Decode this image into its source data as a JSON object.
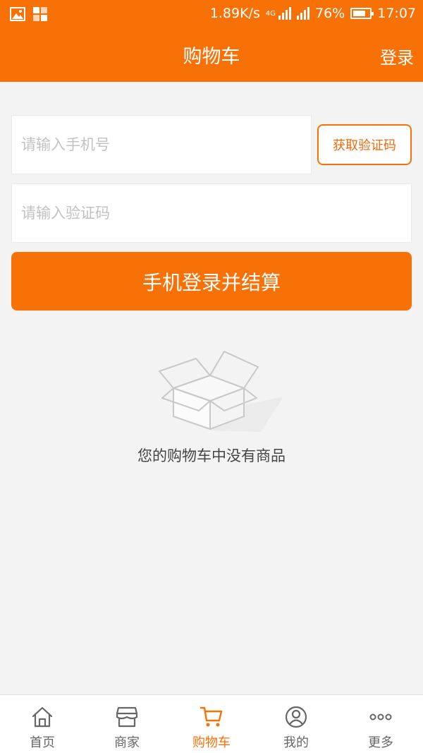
{
  "status_bar": {
    "speed": "1.89K/s",
    "network": "4G",
    "battery_percent": "76%",
    "battery_level": 0.76,
    "time": "17:07"
  },
  "header": {
    "title": "购物车",
    "login_label": "登录"
  },
  "form": {
    "phone_placeholder": "请输入手机号",
    "code_placeholder": "请输入验证码",
    "get_code_label": "获取验证码",
    "submit_label": "手机登录并结算"
  },
  "empty_state": {
    "icon": "empty-box-icon",
    "text": "您的购物车中没有商品"
  },
  "tabbar": {
    "items": [
      {
        "label": "首页",
        "icon": "home-icon",
        "active": false
      },
      {
        "label": "商家",
        "icon": "store-icon",
        "active": false
      },
      {
        "label": "购物车",
        "icon": "cart-icon",
        "active": true
      },
      {
        "label": "我的",
        "icon": "user-icon",
        "active": false
      },
      {
        "label": "更多",
        "icon": "more-icon",
        "active": false
      }
    ]
  },
  "colors": {
    "accent": "#f87107",
    "background": "#f3f3f3",
    "inactive_tab": "#666666"
  }
}
